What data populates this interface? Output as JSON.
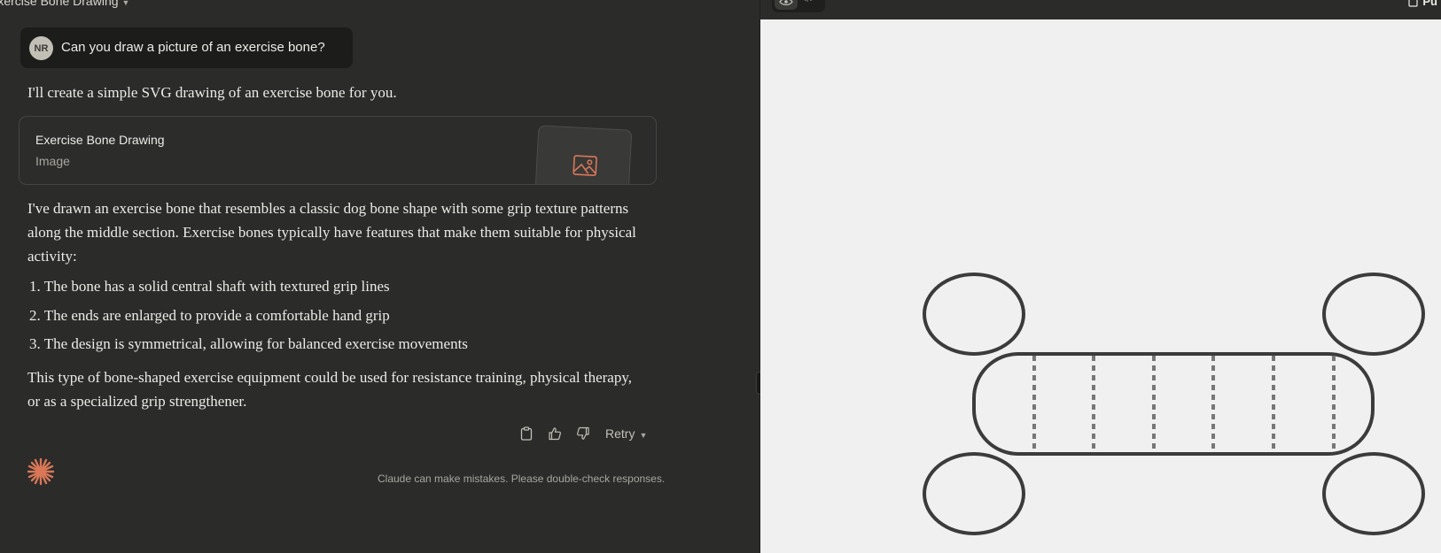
{
  "conversation": {
    "title": "Exercise Bone Drawing"
  },
  "user_message": {
    "initials": "NR",
    "text": "Can you draw a picture of an exercise bone?"
  },
  "assistant": {
    "intro": "I'll create a simple SVG drawing of an exercise bone for you.",
    "artifact": {
      "title": "Exercise Bone Drawing",
      "type": "Image",
      "icon": "image-icon"
    },
    "paragraph1": "I've drawn an exercise bone that resembles a classic dog bone shape with some grip texture patterns along the middle section. Exercise bones typically have features that make them suitable for physical activity:",
    "list": [
      "The bone has a solid central shaft with textured grip lines",
      "The ends are enlarged to provide a comfortable hand grip",
      "The design is symmetrical, allowing for balanced exercise movements"
    ],
    "paragraph2": "This type of bone-shaped exercise equipment could be used for resistance training, physical therapy, or as a specialized grip strengthener.",
    "actions": {
      "copy_icon": "clipboard-icon",
      "like_icon": "thumbs-up-icon",
      "dislike_icon": "thumbs-down-icon",
      "retry_label": "Retry"
    }
  },
  "footer": {
    "disclaimer": "Claude can make mistakes. Please double-check responses."
  },
  "artifact_panel": {
    "view_toggle_icons": [
      "eye-icon",
      "code-icon"
    ],
    "publish_label": "Pu"
  },
  "colors": {
    "background": "#2b2b2a",
    "user_bubble": "#1c1c1b",
    "accent": "#d97757",
    "canvas": "#f0f0f0",
    "bone_stroke": "#3b3b3b",
    "grip_lines": "#777777"
  }
}
